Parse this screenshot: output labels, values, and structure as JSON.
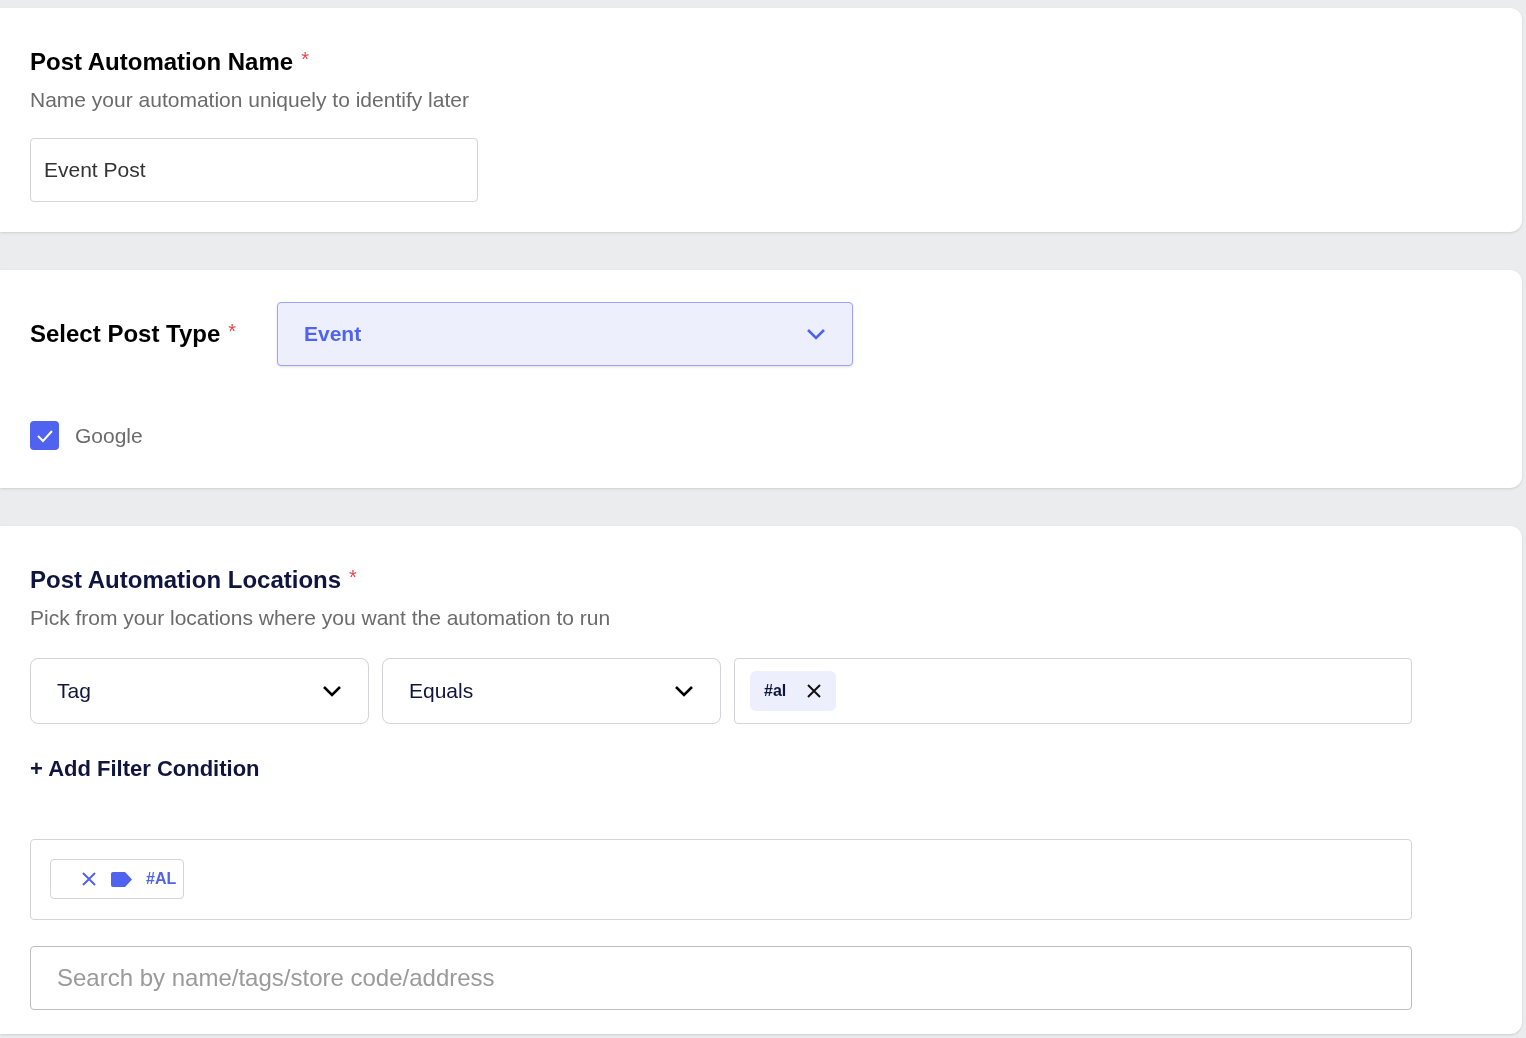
{
  "name_section": {
    "title": "Post Automation Name",
    "required_mark": "*",
    "subtitle": "Name your automation uniquely to identify later",
    "value": "Event Post"
  },
  "post_type_section": {
    "label": "Select Post Type",
    "required_mark": "*",
    "select": {
      "value": "Event"
    },
    "platforms": [
      {
        "label": "Google",
        "checked": true
      }
    ]
  },
  "locations_section": {
    "title": "Post Automation Locations",
    "required_mark": "*",
    "subtitle": "Pick from your locations where you want the automation to run",
    "filter": {
      "field": "Tag",
      "operator": "Equals",
      "chips": [
        "#al"
      ]
    },
    "add_filter": "+ Add Filter Condition",
    "selected_tags": [
      "#AL"
    ],
    "search": {
      "placeholder": "Search by name/tags/store code/address"
    }
  }
}
